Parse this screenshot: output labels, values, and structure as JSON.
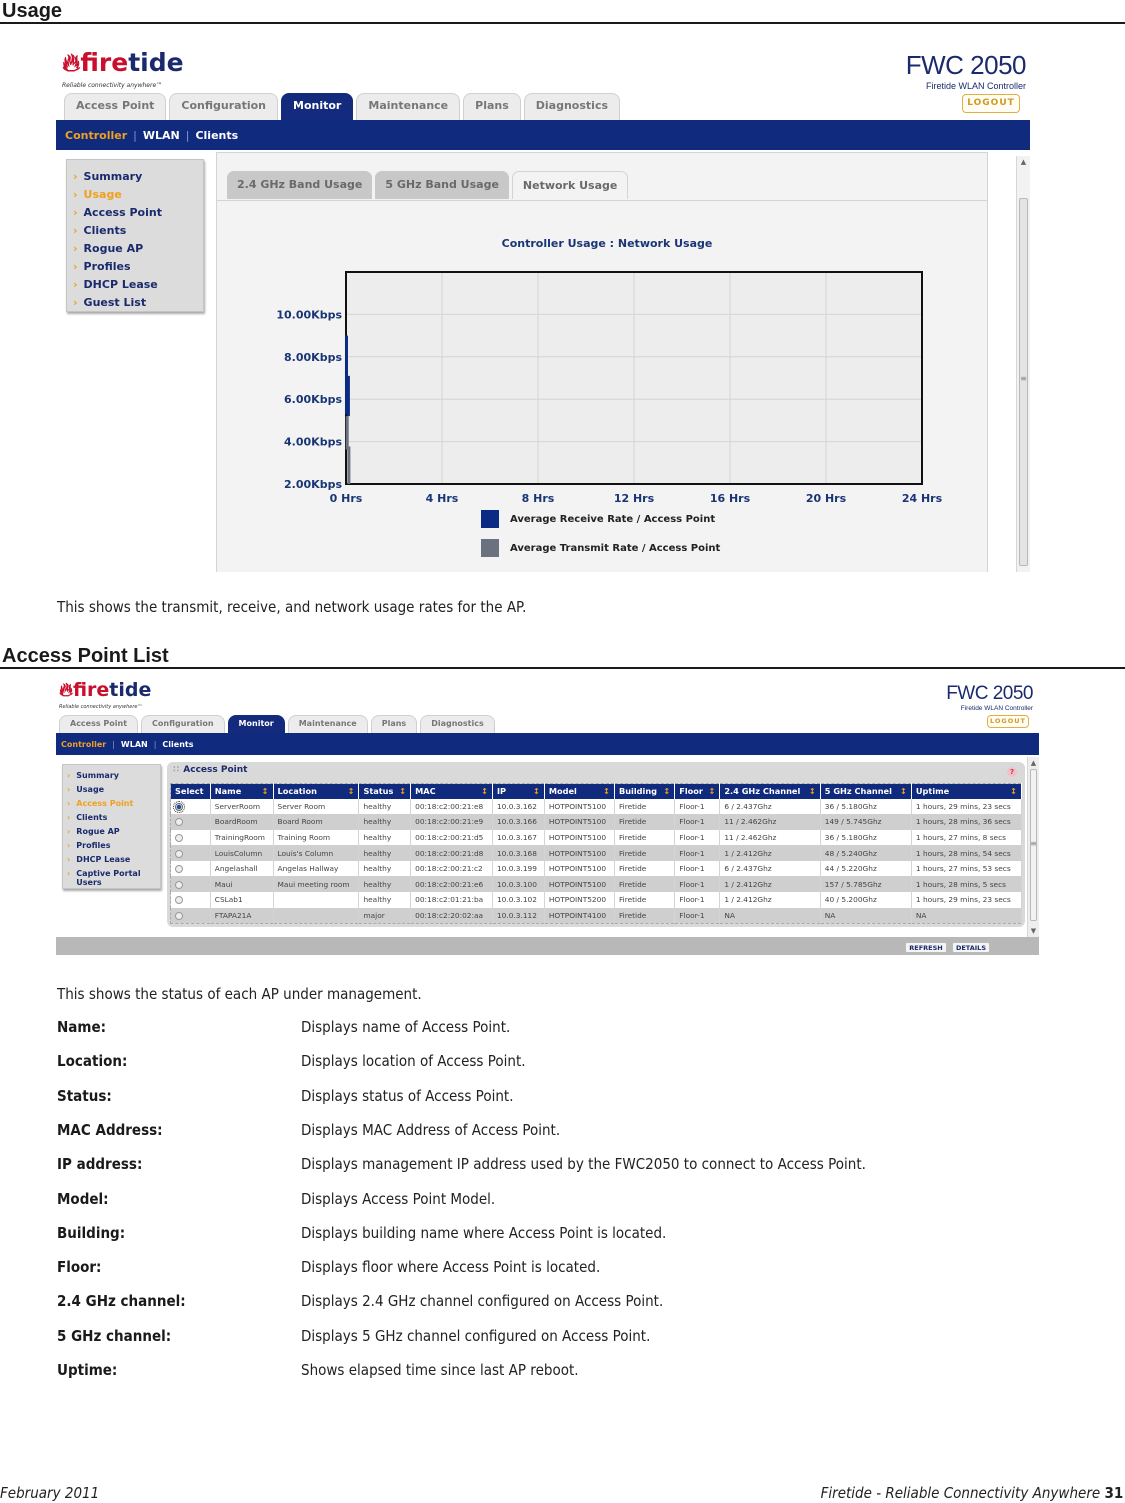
{
  "usage_section": {
    "title": "Usage",
    "caption": "This shows the transmit, receive, and network usage rates for the AP."
  },
  "app": {
    "logo_text_fire": "fire",
    "logo_text_tide": "tide",
    "logo_tagline": "Reliable connectivity anywhere™",
    "product_model": "FWC 2050",
    "product_subtitle": "Firetide WLAN Controller",
    "logout_label": "LOGOUT",
    "main_tabs": [
      {
        "label": "Access Point",
        "active": false
      },
      {
        "label": "Configuration",
        "active": false
      },
      {
        "label": "Monitor",
        "active": true
      },
      {
        "label": "Maintenance",
        "active": false
      },
      {
        "label": "Plans",
        "active": false
      },
      {
        "label": "Diagnostics",
        "active": false
      }
    ],
    "sub_nav": [
      {
        "label": "Controller",
        "active": true
      },
      {
        "label": "WLAN",
        "active": false
      },
      {
        "label": "Clients",
        "active": false
      }
    ],
    "colors": {
      "nav_blue": "#102a7e",
      "accent_orange": "#f0a020",
      "logo_red": "#c8102e"
    }
  },
  "usage_screen": {
    "side_menu": [
      {
        "label": "Summary",
        "active": false
      },
      {
        "label": "Usage",
        "active": true
      },
      {
        "label": "Access Point",
        "active": false
      },
      {
        "label": "Clients",
        "active": false
      },
      {
        "label": "Rogue AP",
        "active": false
      },
      {
        "label": "Profiles",
        "active": false
      },
      {
        "label": "DHCP Lease",
        "active": false
      },
      {
        "label": "Guest List",
        "active": false
      }
    ],
    "sub_tabs": [
      {
        "label": "2.4 GHz Band Usage",
        "active": false
      },
      {
        "label": "5 GHz Band Usage",
        "active": false
      },
      {
        "label": "Network Usage",
        "active": true
      }
    ]
  },
  "chart_data": {
    "type": "line",
    "title": "Controller Usage : Network Usage",
    "xlabel": "",
    "ylabel": "",
    "x_ticks": [
      "0 Hrs",
      "4 Hrs",
      "8 Hrs",
      "12 Hrs",
      "16 Hrs",
      "20 Hrs",
      "24 Hrs"
    ],
    "x_tick_values": [
      0,
      4,
      8,
      12,
      16,
      20,
      24
    ],
    "y_ticks": [
      "2.00Kbps",
      "4.00Kbps",
      "6.00Kbps",
      "8.00Kbps",
      "10.00Kbps"
    ],
    "y_tick_values": [
      2,
      4,
      6,
      8,
      10
    ],
    "xlim": [
      0,
      24
    ],
    "ylim": [
      2,
      12
    ],
    "grid": true,
    "legend_position": "bottom",
    "series": [
      {
        "name": "Average Receive Rate / Access Point",
        "color": "#0b2a84",
        "points": [
          [
            0.02,
            9.0
          ],
          [
            0.02,
            5.3
          ],
          [
            0.1,
            7.1
          ],
          [
            0.1,
            5.2
          ]
        ]
      },
      {
        "name": "Average Transmit Rate / Access Point",
        "color": "#6a7280",
        "points": [
          [
            0.05,
            5.2
          ],
          [
            0.05,
            3.7
          ],
          [
            0.12,
            3.7
          ],
          [
            0.12,
            2.0
          ]
        ]
      }
    ]
  },
  "ap_section": {
    "title": "Access Point List",
    "caption": "This shows the status of each AP under management."
  },
  "ap_screen": {
    "side_menu": [
      {
        "label": "Summary",
        "active": false
      },
      {
        "label": "Usage",
        "active": false
      },
      {
        "label": "Access Point",
        "active": true
      },
      {
        "label": "Clients",
        "active": false
      },
      {
        "label": "Rogue AP",
        "active": false
      },
      {
        "label": "Profiles",
        "active": false
      },
      {
        "label": "DHCP Lease",
        "active": false
      },
      {
        "label": "Captive Portal Users",
        "active": false
      }
    ],
    "panel_title": "Access Point",
    "help_icon": "?",
    "columns": [
      "Select",
      "Name",
      "Location",
      "Status",
      "MAC",
      "IP",
      "Model",
      "Building",
      "Floor",
      "2.4 GHz Channel",
      "5 GHz Channel",
      "Uptime"
    ],
    "sortable": [
      false,
      true,
      true,
      true,
      true,
      true,
      true,
      true,
      true,
      true,
      true,
      true
    ],
    "rows": [
      {
        "selected": true,
        "name": "ServerRoom",
        "location": "Server Room",
        "status": "healthy",
        "mac": "00:18:c2:00:21:e8",
        "ip": "10.0.3.162",
        "model": "HOTPOINT5100",
        "building": "Firetide",
        "floor": "Floor-1",
        "ch24": "6 / 2.437Ghz",
        "ch5": "36 / 5.180Ghz",
        "uptime": "1 hours, 29 mins, 23 secs"
      },
      {
        "selected": false,
        "name": "BoardRoom",
        "location": "Board Room",
        "status": "healthy",
        "mac": "00:18:c2:00:21:e9",
        "ip": "10.0.3.166",
        "model": "HOTPOINT5100",
        "building": "Firetide",
        "floor": "Floor-1",
        "ch24": "11 / 2.462Ghz",
        "ch5": "149 / 5.745Ghz",
        "uptime": "1 hours, 28 mins, 36 secs"
      },
      {
        "selected": false,
        "name": "TrainingRoom",
        "location": "Training Room",
        "status": "healthy",
        "mac": "00:18:c2:00:21:d5",
        "ip": "10.0.3.167",
        "model": "HOTPOINT5100",
        "building": "Firetide",
        "floor": "Floor-1",
        "ch24": "11 / 2.462Ghz",
        "ch5": "36 / 5.180Ghz",
        "uptime": "1 hours, 27 mins, 8 secs"
      },
      {
        "selected": false,
        "name": "LouisColumn",
        "location": "Louis's Column",
        "status": "healthy",
        "mac": "00:18:c2:00:21:d8",
        "ip": "10.0.3.168",
        "model": "HOTPOINT5100",
        "building": "Firetide",
        "floor": "Floor-1",
        "ch24": "1 / 2.412Ghz",
        "ch5": "48 / 5.240Ghz",
        "uptime": "1 hours, 28 mins, 54 secs"
      },
      {
        "selected": false,
        "name": "Angelashall",
        "location": "Angelas Hallway",
        "status": "healthy",
        "mac": "00:18:c2:00:21:c2",
        "ip": "10.0.3.199",
        "model": "HOTPOINT5100",
        "building": "Firetide",
        "floor": "Floor-1",
        "ch24": "6 / 2.437Ghz",
        "ch5": "44 / 5.220Ghz",
        "uptime": "1 hours, 27 mins, 53 secs"
      },
      {
        "selected": false,
        "name": "Maui",
        "location": "Maui meeting room",
        "status": "healthy",
        "mac": "00:18:c2:00:21:e6",
        "ip": "10.0.3.100",
        "model": "HOTPOINT5100",
        "building": "Firetide",
        "floor": "Floor-1",
        "ch24": "1 / 2.412Ghz",
        "ch5": "157 / 5.785Ghz",
        "uptime": "1 hours, 28 mins, 5 secs"
      },
      {
        "selected": false,
        "name": "CSLab1",
        "location": "",
        "status": "healthy",
        "mac": "00:18:c2:01:21:ba",
        "ip": "10.0.3.102",
        "model": "HOTPOINT5200",
        "building": "Firetide",
        "floor": "Floor-1",
        "ch24": "1 / 2.412Ghz",
        "ch5": "40 / 5.200Ghz",
        "uptime": "1 hours, 29 mins, 23 secs"
      },
      {
        "selected": false,
        "name": "FTAPA21A",
        "location": "",
        "status": "major",
        "mac": "00:18:c2:20:02:aa",
        "ip": "10.0.3.112",
        "model": "HOTPOINT4100",
        "building": "Firetide",
        "floor": "Floor-1",
        "ch24": "NA",
        "ch5": "NA",
        "uptime": "NA"
      }
    ],
    "refresh_label": "REFRESH",
    "details_label": "DETAILS"
  },
  "definitions": [
    {
      "term": "Name:",
      "desc": "Displays name of Access Point."
    },
    {
      "term": "Location:",
      "desc": "Displays location of Access Point."
    },
    {
      "term": "Status:",
      "desc": "Displays status of Access Point."
    },
    {
      "term": "MAC Address:",
      "desc": "Displays MAC Address of Access Point."
    },
    {
      "term": "IP address:",
      "desc": "Displays management IP address used by the FWC2050 to connect to Access Point."
    },
    {
      "term": "Model:",
      "desc": "Displays Access Point Model."
    },
    {
      "term": "Building:",
      "desc": "Displays building name where Access Point is located."
    },
    {
      "term": "Floor:",
      "desc": "Displays floor where Access Point is located."
    },
    {
      "term": "2.4 GHz channel:",
      "desc": "Displays 2.4 GHz channel configured on Access Point."
    },
    {
      "term": "5 GHz channel:",
      "desc": "Displays 5 GHz  channel configured on Access Point."
    },
    {
      "term": "Uptime:",
      "desc": "Shows elapsed time since last AP reboot."
    }
  ],
  "footer": {
    "date": "February 2011",
    "tagline": "Firetide - Reliable Connectivity Anywhere",
    "page_number": "31"
  }
}
